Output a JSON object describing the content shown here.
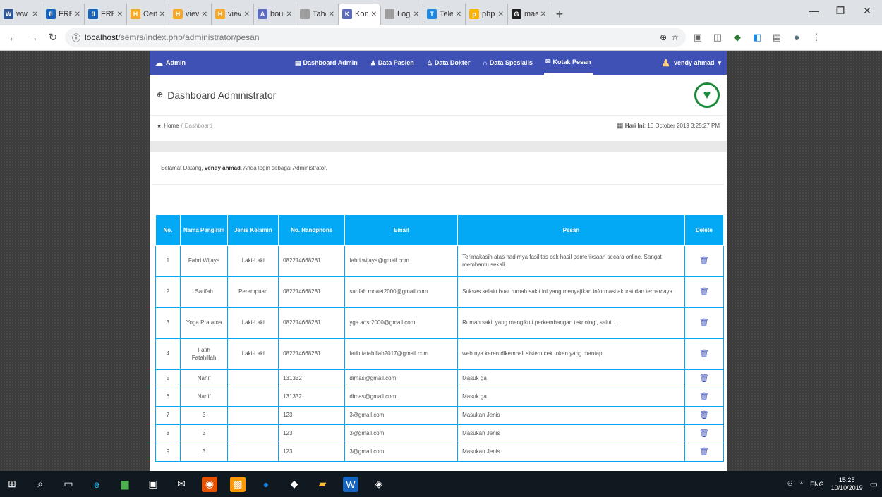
{
  "browser": {
    "tabs": [
      {
        "icon": "W",
        "color": "#2b579a",
        "label": "ww"
      },
      {
        "icon": "fl",
        "color": "#1565c0",
        "label": "FRE"
      },
      {
        "icon": "fl",
        "color": "#1565c0",
        "label": "FRE"
      },
      {
        "icon": "H",
        "color": "#f9a825",
        "label": "Cert"
      },
      {
        "icon": "H",
        "color": "#f9a825",
        "label": "viev"
      },
      {
        "icon": "H",
        "color": "#f9a825",
        "label": "viev"
      },
      {
        "icon": "A",
        "color": "#5c6bc0",
        "label": "bou"
      },
      {
        "icon": "",
        "color": "#9e9e9e",
        "label": "Tabe"
      },
      {
        "icon": "K",
        "color": "#5c6bc0",
        "label": "Kon"
      },
      {
        "icon": "",
        "color": "#9e9e9e",
        "label": "Log"
      },
      {
        "icon": "T",
        "color": "#1e88e5",
        "label": "Tele"
      },
      {
        "icon": "p",
        "color": "#ffb300",
        "label": "php"
      },
      {
        "icon": "G",
        "color": "#222222",
        "label": "mae"
      }
    ],
    "url_host": "localhost",
    "url_path": "/semrs/index.php/administrator/pesan"
  },
  "app": {
    "brand": "Admin",
    "nav": [
      {
        "label": "Dashboard Admin",
        "icon": "▤"
      },
      {
        "label": "Data Pasien",
        "icon": "♟"
      },
      {
        "label": "Data Dokter",
        "icon": "♙"
      },
      {
        "label": "Data Spesialis",
        "icon": "∩"
      },
      {
        "label": "Kotak Pesan",
        "icon": "✉"
      }
    ],
    "user": "vendy ahmad",
    "page_title": "Dashboard Administrator",
    "breadcrumb_home": "Home",
    "breadcrumb_current": "Dashboard",
    "date_label": "Hari Ini",
    "date_value": "10 October 2019 3:25:27 PM",
    "welcome_prefix": "Selamat Datang, ",
    "welcome_name": "vendy ahmad",
    "welcome_suffix": ". Anda login sebagai Administrator."
  },
  "table": {
    "headers": [
      "No.",
      "Nama Pengirim",
      "Jenis Kelamin",
      "No. Handphone",
      "Email",
      "Pesan",
      "Delete"
    ],
    "rows": [
      [
        "1",
        "Fahri Wijaya",
        "Laki-Laki",
        "082214668281",
        "fahri.wijaya@gmail.com",
        "Terimakasih atas hadirnya fasilitas cek hasil pemeriksaan secara online. Sangat membantu sekali."
      ],
      [
        "2",
        "Sarifah",
        "Perempuan",
        "082214668281",
        "sarifah.mnaet2000@gmail.com",
        "Sukses selalu buat rumah sakit ini yang menyajikan informasi akurat dan terpercaya"
      ],
      [
        "3",
        "Yoga Pratama",
        "Laki-Laki",
        "082214668281",
        "yga.adsr2000@gmail.com",
        "Rumah sakit yang mengikuti perkembangan teknologi, salut..."
      ],
      [
        "4",
        "Fatih Fatahillah",
        "Laki-Laki",
        "082214668281",
        "fatih.fatahillah2017@gmail.com",
        "web nya keren dikembali sistem cek token yang mantap"
      ],
      [
        "5",
        "Nanif",
        "",
        "131332",
        "dimas@gmail.com",
        "Masuk ga"
      ],
      [
        "6",
        "Nanif",
        "",
        "131332",
        "dimas@gmail.com",
        "Masuk ga"
      ],
      [
        "7",
        "3",
        "",
        "123",
        "3@gmail.com",
        "Masukan Jenis"
      ],
      [
        "8",
        "3",
        "",
        "123",
        "3@gmail.com",
        "Masukan Jenis"
      ],
      [
        "9",
        "3",
        "",
        "123",
        "3@gmail.com",
        "Masukan Jenis"
      ]
    ]
  },
  "taskbar": {
    "lang": "ENG",
    "time": "15:25",
    "date": "10/10/2019"
  }
}
